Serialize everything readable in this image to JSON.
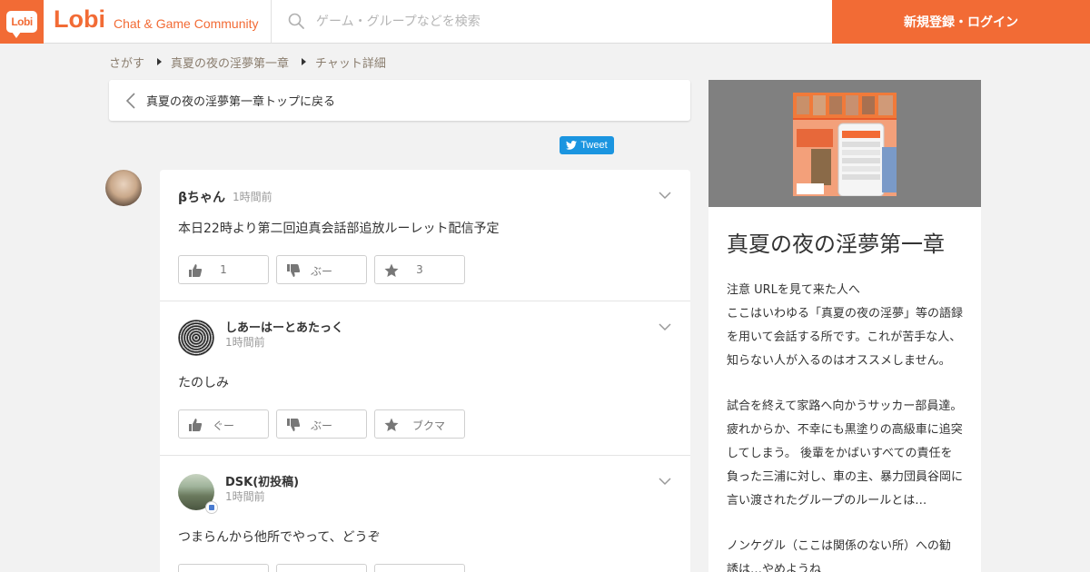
{
  "header": {
    "logo_badge": "Lobi",
    "logo_text": "Lobi",
    "tagline": "Chat & Game Community",
    "search_placeholder": "ゲーム・グループなどを検索",
    "login_label": "新規登録・ログイン",
    "brand_color": "#f26b35"
  },
  "breadcrumb": {
    "items": [
      "さがす",
      "真夏の夜の淫夢第一章",
      "チャット詳細"
    ]
  },
  "back": {
    "label": "真夏の夜の淫夢第一章トップに戻る"
  },
  "tweet": {
    "label": "Tweet"
  },
  "posts": [
    {
      "author": "βちゃん",
      "time": "1時間前",
      "body": "本日22時より第二回迫真会話部追放ルーレット配信予定",
      "likes_label": "1",
      "boo_label": "ぶー",
      "bookmark_label": "3"
    },
    {
      "author": "しあーはーとあたっく",
      "time": "1時間前",
      "body": "たのしみ",
      "likes_label": "ぐー",
      "boo_label": "ぶー",
      "bookmark_label": "ブクマ"
    },
    {
      "author": "DSK(初投稿)",
      "time": "1時間前",
      "body": "つまらんから他所でやって、どうぞ"
    }
  ],
  "sidebar": {
    "group_title": "真夏の夜の淫夢第一章",
    "description_lines": [
      "注意 URLを見て来た人へ",
      "ここはいわゆる「真夏の夜の淫夢」等の語録",
      "を用いて会話する所です。これが苦手な人、",
      "知らない人が入るのはオススメしません。",
      "試合を終えて家路へ向かうサッカー部員達。",
      "疲れからか、不幸にも黒塗りの高級車に追突",
      "してしまう。 後輩をかばいすべての責任を",
      "負った三浦に対し、車の主、暴力団員谷岡に",
      "言い渡されたグループのルールとは…",
      "ノンケグル（ここは関係のない所）への勧",
      "誘は…やめようね"
    ]
  },
  "icons": {
    "search": "search-icon",
    "back": "chevron-left-icon",
    "menu": "chevron-down-icon",
    "like": "thumbs-up-icon",
    "boo": "thumbs-down-icon",
    "bookmark": "star-icon",
    "twitter": "twitter-bird-icon"
  }
}
